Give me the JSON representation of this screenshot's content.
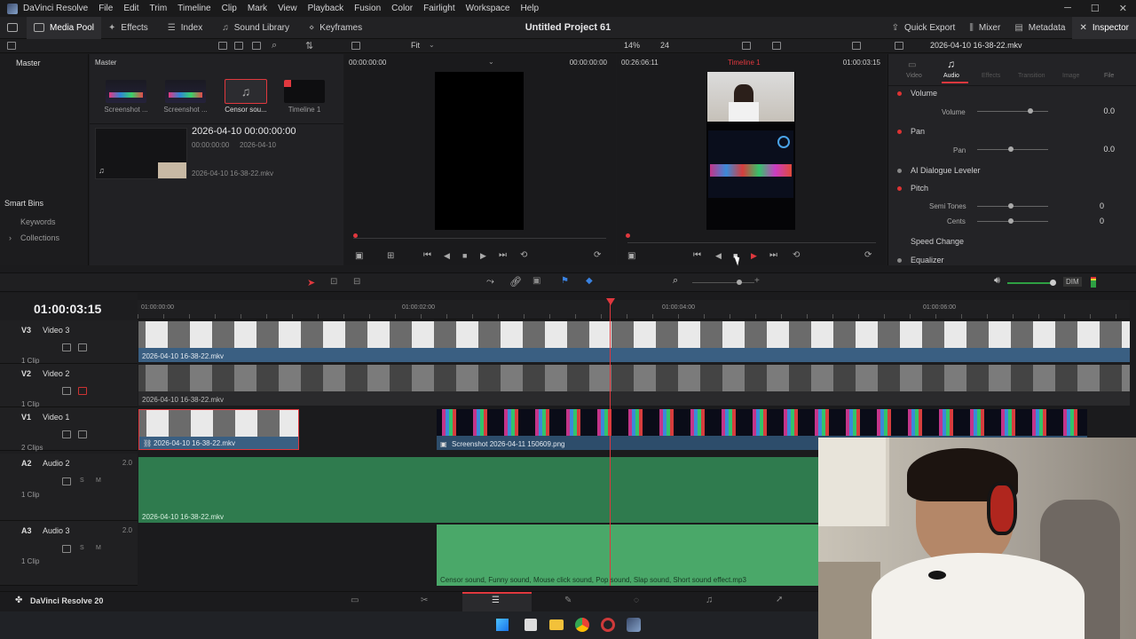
{
  "menubar": {
    "app_name": "DaVinci Resolve",
    "items": [
      "File",
      "Edit",
      "Trim",
      "Timeline",
      "Clip",
      "Mark",
      "View",
      "Playback",
      "Fusion",
      "Color",
      "Fairlight",
      "Workspace",
      "Help"
    ]
  },
  "toolbar": {
    "media_pool": "Media Pool",
    "effects": "Effects",
    "index": "Index",
    "sound_library": "Sound Library",
    "keyframes": "Keyframes",
    "project_title": "Untitled Project 61",
    "quick_export": "Quick Export",
    "mixer": "Mixer",
    "metadata": "Metadata",
    "inspector": "Inspector"
  },
  "subbar": {
    "fit": "Fit",
    "zoom": "14%",
    "fps": "24",
    "inspector_clip": "2026-04-10 16-38-22.mkv"
  },
  "bins": {
    "master": "Master",
    "smart_bins": "Smart Bins",
    "keywords": "Keywords",
    "collections": "Collections"
  },
  "pool": {
    "header": "Master",
    "items": [
      {
        "label": "Screenshot ..."
      },
      {
        "label": "Screenshot ..."
      },
      {
        "label": "Censor sou..."
      },
      {
        "label": "Timeline 1"
      }
    ],
    "detail_title": "2026-04-10  00:00:00:00",
    "detail_tc": "00:00:00:00",
    "detail_date": "2026-04-10",
    "detail_file": "2026-04-10 16-38-22.mkv"
  },
  "source": {
    "tc_left": "00:00:00:00",
    "tc_right": "00:00:00:00"
  },
  "timeline_viewer": {
    "tc_left": "00:26:06:11",
    "name": "Timeline 1",
    "tc_right": "01:00:03:15"
  },
  "inspector": {
    "tabs": [
      "Video",
      "Audio",
      "Effects",
      "Transition",
      "Image",
      "File"
    ],
    "active_tab": "Audio",
    "volume": "Volume",
    "volume_label": "Volume",
    "volume_value": "0.0",
    "pan": "Pan",
    "pan_label": "Pan",
    "pan_value": "0.0",
    "ai_dialogue": "AI Dialogue Leveler",
    "pitch": "Pitch",
    "semi_tones": "Semi Tones",
    "semi_value": "0",
    "cents": "Cents",
    "cents_value": "0",
    "speed_change": "Speed Change",
    "equalizer": "Equalizer"
  },
  "timeline": {
    "timecode": "01:00:03:15",
    "ruler": [
      "01:00:00:00",
      "01:00:02:00",
      "01:00:04:00",
      "01:00:06:00"
    ],
    "dim": "DIM",
    "tracks": [
      {
        "id": "V3",
        "name": "Video 3",
        "clips": "1 Clip",
        "clip_label": "2026-04-10 16-38-22.mkv"
      },
      {
        "id": "V2",
        "name": "Video 2",
        "clips": "1 Clip",
        "clip_label": "2026-04-10 16-38-22.mkv"
      },
      {
        "id": "V1",
        "name": "Video 1",
        "clips": "2 Clips",
        "clip_label": "2026-04-10 16-38-22.mkv",
        "clip2_label": "Screenshot 2026-04-11 150609.png"
      },
      {
        "id": "A2",
        "name": "Audio 2",
        "vol": "2.0",
        "clips": "1 Clip",
        "clip_label": "2026-04-10 16-38-22.mkv"
      },
      {
        "id": "A3",
        "name": "Audio 3",
        "vol": "2.0",
        "clips": "1 Clip",
        "clip_label": "Censor sound, Funny sound, Mouse click sound, Pop sound, Slap sound, Short sound effect.mp3"
      }
    ]
  },
  "bottom": {
    "app_label": "DaVinci Resolve 20"
  },
  "colors": {
    "accent_red": "#e0383e",
    "video_clip": "#3a5f82",
    "audio_clip": "#2f7b4e"
  }
}
